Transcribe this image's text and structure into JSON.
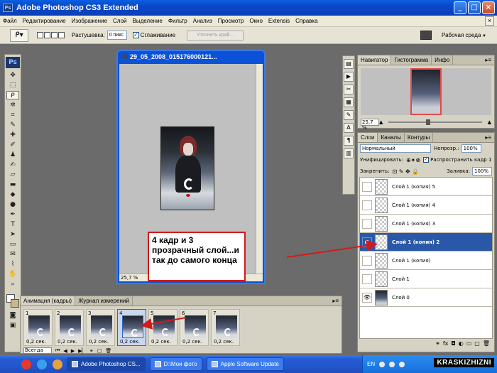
{
  "window": {
    "title": "Adobe Photoshop CS3 Extended"
  },
  "menu": [
    "Файл",
    "Редактирование",
    "Изображение",
    "Слой",
    "Выделение",
    "Фильтр",
    "Анализ",
    "Просмотр",
    "Окно",
    "Extensis",
    "Справка"
  ],
  "options": {
    "feather_label": "Растушевка:",
    "feather_value": "0 пикс",
    "antialias_label": "Сглаживание",
    "refine_label": "Уточнить край...",
    "workspace_label": "Рабочая среда"
  },
  "document": {
    "title": "29_05_2008_015176000121...",
    "zoom": "25,7 %"
  },
  "annotation": {
    "text": "4 кадр и 3 прозрачный слой...и так до самого конца"
  },
  "navigator": {
    "tabs": [
      "Навигатор",
      "Гистограмма",
      "Инфо"
    ],
    "zoom": "25,7 %"
  },
  "layers_panel": {
    "tabs": [
      "Слои",
      "Каналы",
      "Контуры"
    ],
    "blend_mode": "Нормальный",
    "opacity_label": "Непрозр.:",
    "opacity_value": "100%",
    "unify_label": "Унифицировать:",
    "propagate_label": "Распространить кадр 1",
    "lock_label": "Закрепить:",
    "fill_label": "Заливка:",
    "fill_value": "100%",
    "layers": [
      {
        "name": "Слой 1 (копия) 5",
        "visible": false,
        "active": false,
        "thumb": "transparent"
      },
      {
        "name": "Слой 1 (копия) 4",
        "visible": false,
        "active": false,
        "thumb": "transparent"
      },
      {
        "name": "Слой 1 (копия) 3",
        "visible": false,
        "active": false,
        "thumb": "transparent"
      },
      {
        "name": "Слой 1 (копия) 2",
        "visible": true,
        "active": true,
        "thumb": "transparent"
      },
      {
        "name": "Слой 1 (копия)",
        "visible": false,
        "active": false,
        "thumb": "transparent"
      },
      {
        "name": "Слой 1",
        "visible": false,
        "active": false,
        "thumb": "transparent"
      },
      {
        "name": "Слой 0",
        "visible": true,
        "active": false,
        "thumb": "image"
      }
    ]
  },
  "animation": {
    "tabs": [
      "Анимация (кадры)",
      "Журнал измерений"
    ],
    "loop_value": "Всегда",
    "frames": [
      {
        "num": "1",
        "time": "0,2 сек."
      },
      {
        "num": "2",
        "time": "0,2 сек."
      },
      {
        "num": "3",
        "time": "0,2 сек."
      },
      {
        "num": "4",
        "time": "0,2 сек."
      },
      {
        "num": "5",
        "time": "0,2 сек."
      },
      {
        "num": "6",
        "time": "0,2 сек."
      },
      {
        "num": "7",
        "time": "0,2 сек."
      }
    ],
    "active_frame": 3
  },
  "taskbar": {
    "items": [
      "Adobe Photoshop CS...",
      "D:\\Мои фото",
      "Apple Software Update"
    ],
    "lang": "EN",
    "brand": "KRASKIZHIZNI"
  },
  "colors": {
    "accent": "#2a58a8",
    "annotation_red": "#d31a1a",
    "title_blue": "#0a48c8"
  }
}
